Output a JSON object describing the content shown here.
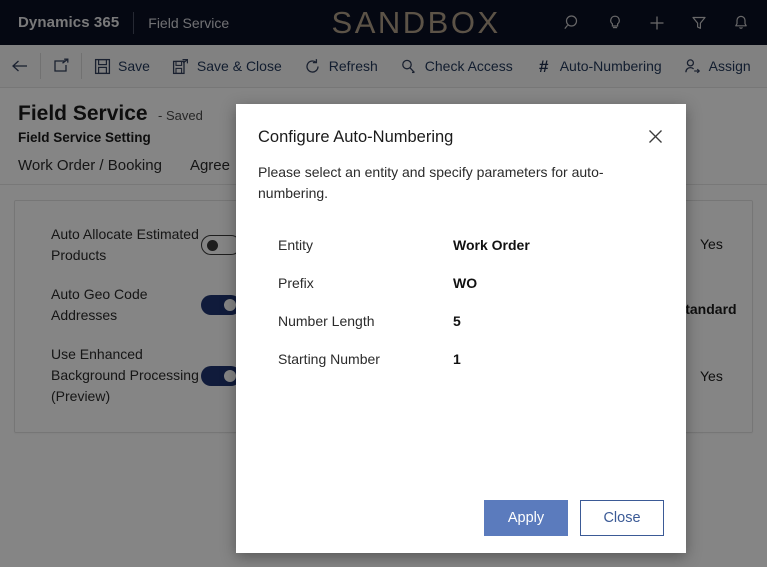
{
  "topnav": {
    "brand": "Dynamics 365",
    "app_name": "Field Service",
    "environment_banner": "SANDBOX",
    "icons": [
      {
        "name": "search-icon",
        "label": "Search"
      },
      {
        "name": "lightbulb-icon",
        "label": "Assistant"
      },
      {
        "name": "plus-icon",
        "label": "Quick Create"
      },
      {
        "name": "filter-icon",
        "label": "Filter"
      },
      {
        "name": "bell-icon",
        "label": "Notifications"
      }
    ]
  },
  "commandbar": {
    "back_label": "Back",
    "popout_label": "Open in new window",
    "items": [
      {
        "label": "Save",
        "icon": "save-icon"
      },
      {
        "label": "Save & Close",
        "icon": "save-close-icon"
      },
      {
        "label": "Refresh",
        "icon": "refresh-icon"
      },
      {
        "label": "Check Access",
        "icon": "key-icon"
      },
      {
        "label": "Auto-Numbering",
        "icon": "hash-icon"
      },
      {
        "label": "Assign",
        "icon": "assign-user-icon"
      }
    ]
  },
  "page": {
    "title": "Field Service",
    "status": "- Saved",
    "subtitle": "Field Service Setting",
    "tabs": [
      {
        "label": "Work Order / Booking"
      },
      {
        "label": "Agree"
      }
    ],
    "settings": [
      {
        "label": "Auto Allocate Estimated Products",
        "toggle": "off",
        "value": "Yes"
      },
      {
        "label": "Auto Geo Code Addresses",
        "toggle": "on",
        "value": "/Standard"
      },
      {
        "label": "Use Enhanced Background Processing (Preview)",
        "toggle": "on",
        "value": "Yes"
      }
    ]
  },
  "dialog": {
    "title": "Configure Auto-Numbering",
    "close_label": "✕",
    "description": "Please select an entity and specify parameters for auto-numbering.",
    "fields": [
      {
        "label": "Entity",
        "value": "Work Order"
      },
      {
        "label": "Prefix",
        "value": "WO"
      },
      {
        "label": "Number Length",
        "value": "5"
      },
      {
        "label": "Starting Number",
        "value": "1"
      }
    ],
    "primary_button": "Apply",
    "secondary_button": "Close"
  },
  "colors": {
    "nav_background": "#0b1124",
    "sandbox_text": "#b9a78f",
    "command_text": "#23395b",
    "toggle_on": "#1f3571",
    "primary_button": "#5b7bbd",
    "secondary_button_border": "#3b5a96"
  }
}
